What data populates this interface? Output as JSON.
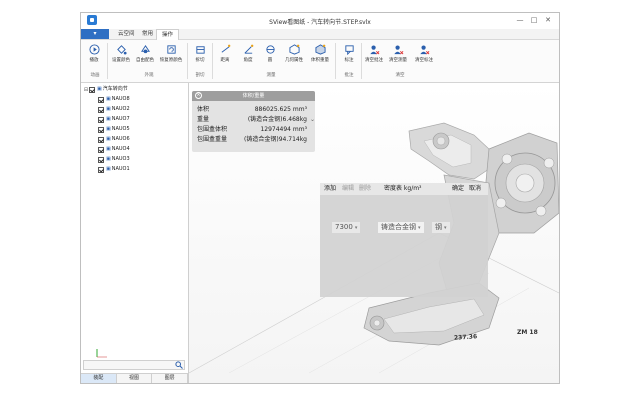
{
  "window": {
    "title": "SView看图纸 - 汽车转向节.STEP.svlx",
    "controls": [
      "—",
      "□",
      "✕"
    ]
  },
  "menu": {
    "file_label": "",
    "tabs": [
      "云空间",
      "常用",
      "操作"
    ],
    "active_tab": "操作"
  },
  "ribbon": {
    "buttons": [
      {
        "label": "播放",
        "icon": "play-icon"
      },
      {
        "label": "设置颜色",
        "icon": "paint-bucket-icon"
      },
      {
        "label": "自由配色",
        "icon": "color-palette-icon"
      },
      {
        "label": "恢复原颜色",
        "icon": "restore-color-icon"
      },
      {
        "label": "拆切",
        "icon": "section-cut-icon"
      },
      {
        "label": "距离",
        "icon": "distance-icon"
      },
      {
        "label": "角度",
        "icon": "angle-icon"
      },
      {
        "label": "圆",
        "icon": "circle-measure-icon"
      },
      {
        "label": "几何属性",
        "icon": "geometry-property-icon"
      },
      {
        "label": "体积重量",
        "icon": "volume-weight-icon"
      },
      {
        "label": "标注",
        "icon": "annotation-icon"
      },
      {
        "label": "清空批注",
        "icon": "clear-markup-icon"
      },
      {
        "label": "清空测量",
        "icon": "clear-measure-icon"
      },
      {
        "label": "清空标注",
        "icon": "clear-annotation-icon"
      }
    ],
    "groups": [
      "动画",
      "外观",
      "剖切",
      "测量",
      "批注",
      "清空"
    ]
  },
  "tree": {
    "root": "汽车转向节",
    "children": [
      "NAUO8",
      "NAUO2",
      "NAUO7",
      "NAUO5",
      "NAUO6",
      "NAUO4",
      "NAUO3",
      "NAUO1"
    ]
  },
  "bottom_tabs": [
    "装配",
    "视图",
    "图层"
  ],
  "props_panel": {
    "title": "体积/重量",
    "rows": [
      {
        "key": "体积",
        "value": "886025.625 mm³"
      },
      {
        "key": "重量",
        "value": "(铸造合金钢)6.468kg"
      },
      {
        "key": "包围盒体积",
        "value": "12974494 mm³"
      },
      {
        "key": "包围盒重量",
        "value": "(铸造合金钢)94.714kg"
      }
    ]
  },
  "density_panel": {
    "add": "添加",
    "edit": "编辑",
    "delete": "删除",
    "title": "密度表 kg/m³",
    "confirm": "确定",
    "cancel": "取消",
    "density_value": "7300",
    "material": "铸造合金钢",
    "category": "钢"
  },
  "dimensions": [
    "237.36",
    "ZM 18"
  ],
  "colors": {
    "accent": "#2f6fc3",
    "ribbon_icon": "#2b5fad"
  }
}
